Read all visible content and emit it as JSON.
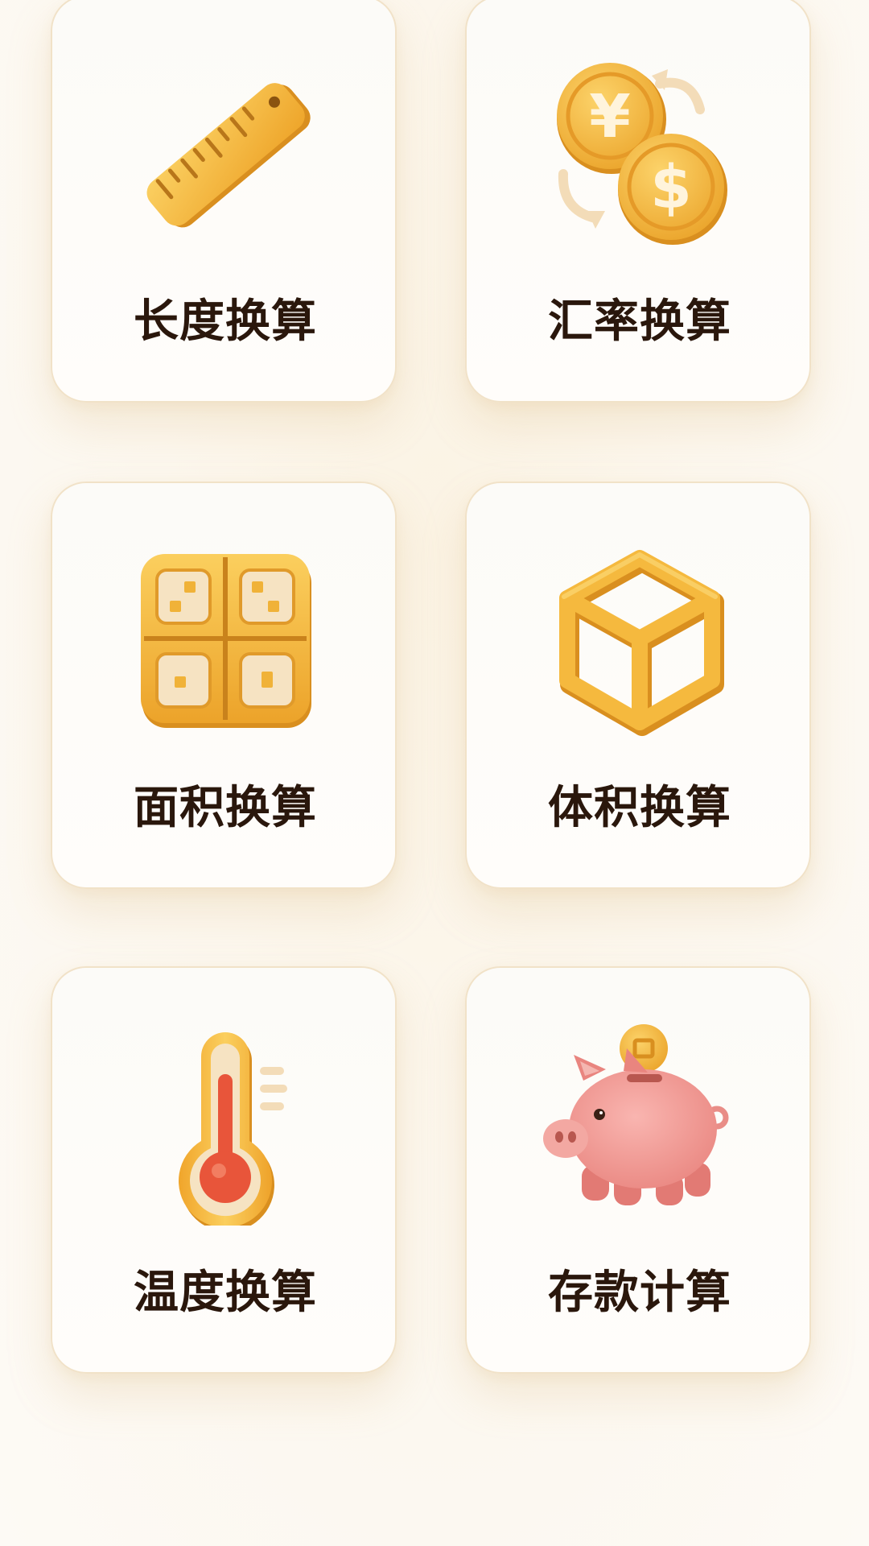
{
  "cards": [
    {
      "label": "长度换算",
      "icon": "ruler-icon"
    },
    {
      "label": "汇率换算",
      "icon": "currency-exchange-icon"
    },
    {
      "label": "面积换算",
      "icon": "area-grid-icon"
    },
    {
      "label": "体积换算",
      "icon": "cube-icon"
    },
    {
      "label": "温度换算",
      "icon": "thermometer-icon"
    },
    {
      "label": "存款计算",
      "icon": "piggy-bank-icon"
    }
  ],
  "colors": {
    "accent": "#f2b43a",
    "accent_dark": "#d98f1f",
    "label_text": "#2a170c",
    "card_border": "#f1e2c8",
    "thermometer_red": "#e8553a",
    "piggy_pink": "#f19a9a"
  }
}
